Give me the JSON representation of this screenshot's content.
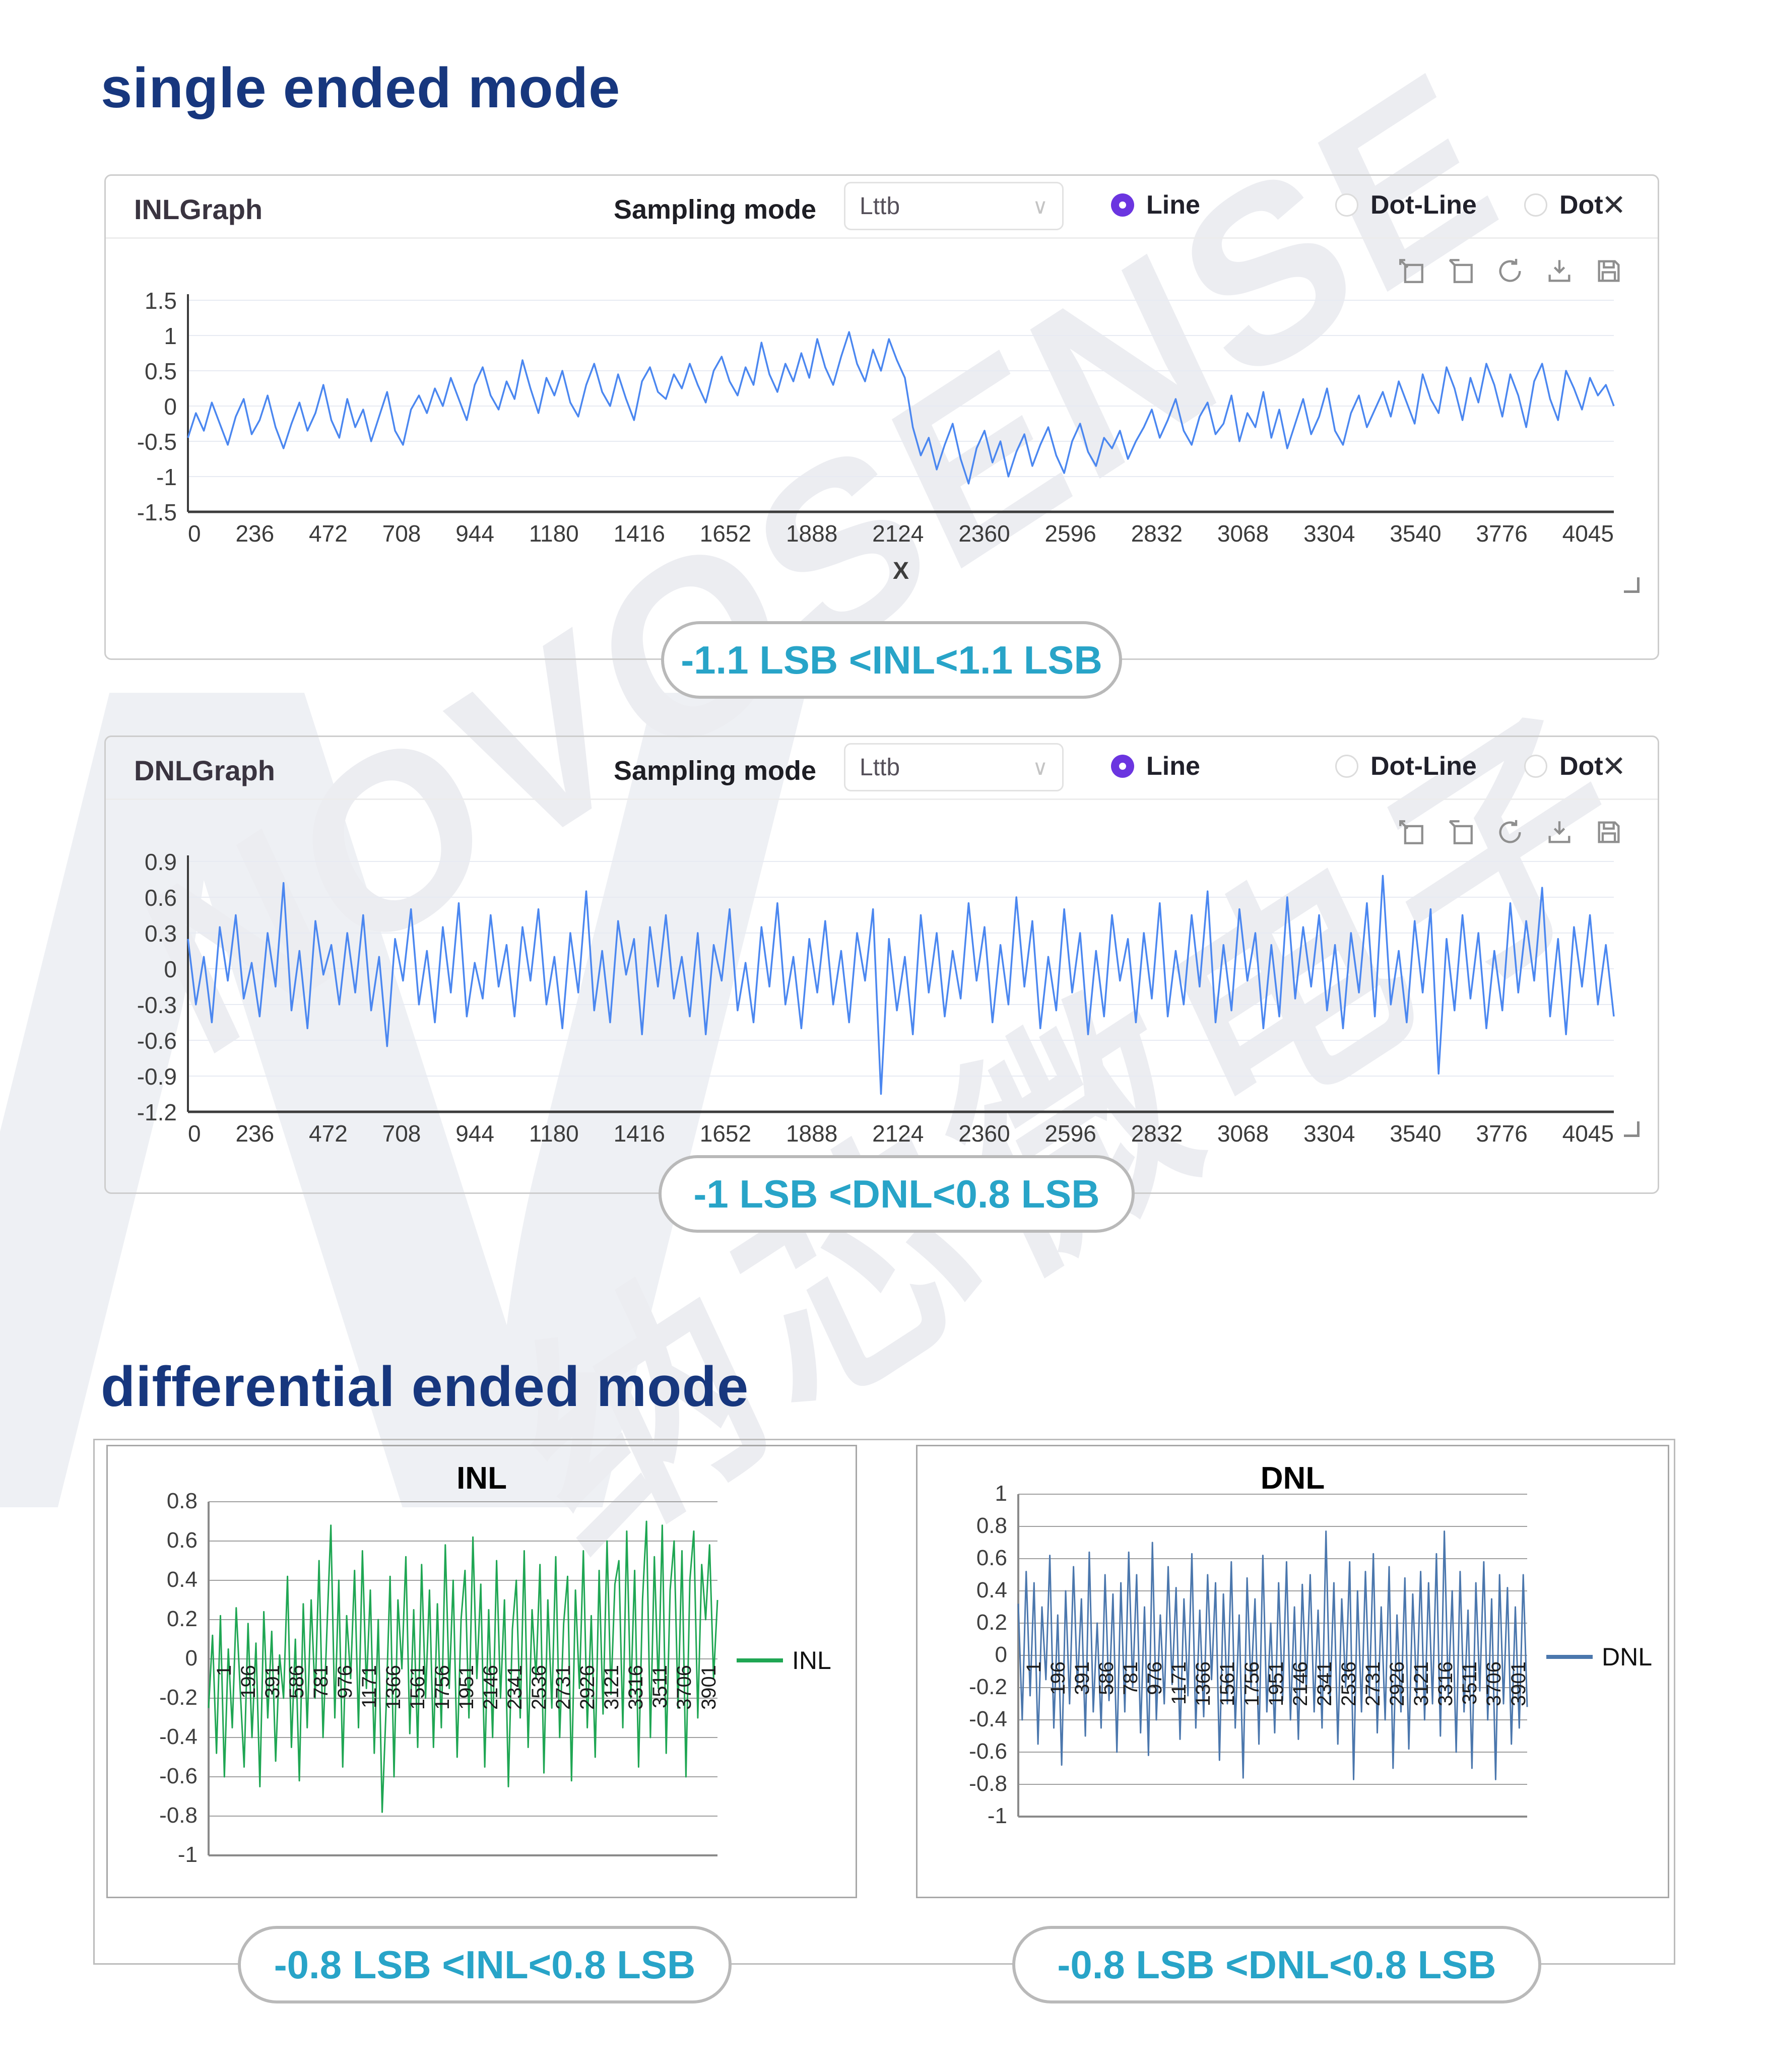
{
  "page": {
    "title1": "single ended mode",
    "title2": "differential ended mode"
  },
  "watermark": {
    "letter": "N",
    "line1": "NOVOSENSE",
    "line2": "纳芯微电子"
  },
  "toolbar": {
    "icons": [
      "zoom-in",
      "zoom-reset",
      "refresh",
      "download",
      "save"
    ]
  },
  "panels": [
    {
      "title": "INLGraph",
      "sampling_label": "Sampling mode",
      "sampling_value": "Lttb",
      "radios": [
        {
          "label": "Line",
          "selected": true
        },
        {
          "label": "Dot-Line",
          "selected": false
        },
        {
          "label": "Dot",
          "selected": false
        }
      ],
      "close": "✕"
    },
    {
      "title": "DNLGraph",
      "sampling_label": "Sampling mode",
      "sampling_value": "Lttb",
      "radios": [
        {
          "label": "Line",
          "selected": true
        },
        {
          "label": "Dot-Line",
          "selected": false
        },
        {
          "label": "Dot",
          "selected": false
        }
      ],
      "close": "✕"
    }
  ],
  "chart_data": [
    {
      "type": "line",
      "name": "INL single-ended",
      "color": "#4b87f0",
      "x_label": "X",
      "xlim": [
        0,
        4045
      ],
      "ylim": [
        -1.5,
        1.5
      ],
      "grid": true,
      "y_ticks": [
        "1.5",
        "1",
        "0.5",
        "0",
        "-0.5",
        "-1",
        "-1.5"
      ],
      "x_ticks": [
        "0",
        "236",
        "472",
        "708",
        "944",
        "1180",
        "1416",
        "1652",
        "1888",
        "2124",
        "2360",
        "2596",
        "2832",
        "3068",
        "3304",
        "3540",
        "3776",
        "4045"
      ],
      "annotation": "-1.1 LSB <INL<1.1 LSB",
      "values": [
        -0.45,
        -0.1,
        -0.35,
        0.05,
        -0.25,
        -0.55,
        -0.15,
        0.1,
        -0.4,
        -0.2,
        0.15,
        -0.3,
        -0.6,
        -0.25,
        0.05,
        -0.35,
        -0.1,
        0.3,
        -0.2,
        -0.45,
        0.1,
        -0.3,
        -0.05,
        -0.5,
        -0.15,
        0.2,
        -0.35,
        -0.55,
        -0.05,
        0.15,
        -0.1,
        0.25,
        0.0,
        0.4,
        0.1,
        -0.2,
        0.3,
        0.55,
        0.15,
        -0.05,
        0.35,
        0.1,
        0.65,
        0.25,
        -0.1,
        0.4,
        0.15,
        0.5,
        0.05,
        -0.15,
        0.3,
        0.6,
        0.2,
        0.0,
        0.45,
        0.1,
        -0.2,
        0.35,
        0.55,
        0.2,
        0.1,
        0.45,
        0.25,
        0.6,
        0.3,
        0.05,
        0.5,
        0.7,
        0.35,
        0.15,
        0.55,
        0.3,
        0.9,
        0.45,
        0.2,
        0.6,
        0.35,
        0.75,
        0.4,
        0.95,
        0.55,
        0.3,
        0.7,
        1.05,
        0.6,
        0.35,
        0.8,
        0.5,
        0.95,
        0.65,
        0.4,
        -0.3,
        -0.7,
        -0.45,
        -0.9,
        -0.55,
        -0.25,
        -0.75,
        -1.1,
        -0.6,
        -0.35,
        -0.8,
        -0.5,
        -1.0,
        -0.65,
        -0.4,
        -0.85,
        -0.55,
        -0.3,
        -0.7,
        -0.95,
        -0.5,
        -0.25,
        -0.65,
        -0.85,
        -0.45,
        -0.6,
        -0.35,
        -0.75,
        -0.5,
        -0.3,
        -0.05,
        -0.45,
        -0.2,
        0.1,
        -0.35,
        -0.55,
        -0.15,
        0.05,
        -0.4,
        -0.25,
        0.15,
        -0.5,
        -0.1,
        -0.3,
        0.2,
        -0.45,
        -0.05,
        -0.6,
        -0.25,
        0.1,
        -0.4,
        -0.15,
        0.25,
        -0.35,
        -0.55,
        -0.1,
        0.15,
        -0.3,
        -0.05,
        0.2,
        -0.15,
        0.35,
        0.05,
        -0.25,
        0.45,
        0.1,
        -0.1,
        0.55,
        0.25,
        -0.2,
        0.4,
        0.05,
        0.6,
        0.3,
        -0.15,
        0.45,
        0.15,
        -0.3,
        0.35,
        0.6,
        0.1,
        -0.2,
        0.5,
        0.25,
        -0.05,
        0.4,
        0.15,
        0.3,
        0.0
      ]
    },
    {
      "type": "line",
      "name": "DNL single-ended",
      "color": "#4b87f0",
      "x_label": "X",
      "xlim": [
        0,
        4045
      ],
      "ylim": [
        -1.2,
        0.9
      ],
      "grid": true,
      "y_ticks": [
        "0.9",
        "0.6",
        "0.3",
        "0",
        "-0.3",
        "-0.6",
        "-0.9",
        "-1.2"
      ],
      "x_ticks": [
        "0",
        "236",
        "472",
        "708",
        "944",
        "1180",
        "1416",
        "1652",
        "1888",
        "2124",
        "2360",
        "2596",
        "2832",
        "3068",
        "3304",
        "3540",
        "3776",
        "4045"
      ],
      "annotation": "-1 LSB <DNL<0.8 LSB",
      "values": [
        0.25,
        -0.3,
        0.1,
        -0.45,
        0.35,
        -0.1,
        0.45,
        -0.25,
        0.05,
        -0.4,
        0.3,
        -0.15,
        0.72,
        -0.35,
        0.15,
        -0.5,
        0.4,
        -0.05,
        0.2,
        -0.3,
        0.3,
        -0.2,
        0.45,
        -0.35,
        0.1,
        -0.65,
        0.25,
        -0.1,
        0.5,
        -0.3,
        0.15,
        -0.45,
        0.35,
        -0.2,
        0.55,
        -0.4,
        0.05,
        -0.25,
        0.45,
        -0.15,
        0.2,
        -0.4,
        0.35,
        -0.1,
        0.5,
        -0.3,
        0.1,
        -0.5,
        0.3,
        -0.2,
        0.65,
        -0.35,
        0.15,
        -0.45,
        0.4,
        -0.05,
        0.25,
        -0.55,
        0.35,
        -0.15,
        0.45,
        -0.25,
        0.1,
        -0.4,
        0.3,
        -0.55,
        0.2,
        -0.1,
        0.5,
        -0.35,
        0.05,
        -0.45,
        0.35,
        -0.15,
        0.55,
        -0.3,
        0.1,
        -0.5,
        0.25,
        -0.2,
        0.4,
        -0.3,
        0.15,
        -0.45,
        0.3,
        -0.1,
        0.5,
        -1.05,
        0.25,
        -0.35,
        0.1,
        -0.55,
        0.45,
        -0.2,
        0.3,
        -0.4,
        0.15,
        -0.25,
        0.55,
        -0.1,
        0.35,
        -0.45,
        0.2,
        -0.3,
        0.6,
        -0.15,
        0.4,
        -0.5,
        0.1,
        -0.35,
        0.5,
        -0.2,
        0.3,
        -0.55,
        0.15,
        -0.4,
        0.45,
        -0.1,
        0.25,
        -0.45,
        0.3,
        -0.25,
        0.55,
        -0.4,
        0.15,
        -0.3,
        0.45,
        -0.15,
        0.65,
        -0.45,
        0.2,
        -0.35,
        0.5,
        -0.1,
        0.3,
        -0.5,
        0.2,
        -0.4,
        0.6,
        -0.25,
        0.35,
        -0.15,
        0.45,
        -0.35,
        0.2,
        -0.5,
        0.3,
        -0.2,
        0.55,
        -0.4,
        0.78,
        -0.3,
        0.15,
        -0.45,
        0.4,
        -0.2,
        0.5,
        -0.88,
        0.25,
        -0.35,
        0.45,
        -0.25,
        0.3,
        -0.5,
        0.15,
        -0.35,
        0.55,
        -0.2,
        0.4,
        -0.1,
        0.68,
        -0.4,
        0.25,
        -0.55,
        0.35,
        -0.15,
        0.45,
        -0.3,
        0.2,
        -0.4
      ]
    },
    {
      "type": "line",
      "name": "INL differential",
      "title": "INL",
      "legend": "INL",
      "color": "#1fa653",
      "xlim": [
        1,
        3996
      ],
      "ylim": [
        -1,
        0.8
      ],
      "grid": true,
      "legend_position": "right",
      "y_ticks": [
        "0.8",
        "0.6",
        "0.4",
        "0.2",
        "0",
        "-0.2",
        "-0.4",
        "-0.6",
        "-0.8",
        "-1"
      ],
      "x_ticks": [
        "1",
        "196",
        "391",
        "586",
        "781",
        "976",
        "1171",
        "1366",
        "1561",
        "1756",
        "1951",
        "2146",
        "2341",
        "2536",
        "2731",
        "2926",
        "3121",
        "3316",
        "3511",
        "3706",
        "3901"
      ],
      "annotation": "-0.8 LSB <INL<0.8 LSB",
      "values": [
        -0.25,
        0.12,
        -0.48,
        0.22,
        -0.6,
        0.05,
        -0.35,
        0.26,
        -0.15,
        -0.55,
        0.18,
        -0.4,
        0.08,
        -0.65,
        0.24,
        -0.3,
        0.14,
        -0.52,
        0.02,
        -0.2,
        0.42,
        -0.45,
        0.1,
        -0.62,
        0.28,
        -0.35,
        0.3,
        -0.2,
        0.5,
        -0.4,
        0.15,
        0.68,
        -0.3,
        0.4,
        -0.55,
        0.22,
        -0.1,
        0.45,
        -0.35,
        0.55,
        -0.15,
        0.35,
        -0.48,
        0.2,
        -0.78,
        -0.25,
        0.42,
        -0.6,
        0.3,
        -0.05,
        0.52,
        -0.38,
        0.25,
        -0.45,
        0.48,
        -0.2,
        0.35,
        -0.45,
        0.28,
        -0.35,
        0.58,
        -0.15,
        0.4,
        -0.5,
        0.2,
        0.45,
        -0.3,
        0.62,
        -0.1,
        0.38,
        -0.55,
        0.25,
        -0.4,
        0.5,
        -0.2,
        0.3,
        -0.65,
        0.15,
        0.4,
        -0.3,
        0.55,
        -0.45,
        0.25,
        -0.1,
        0.48,
        -0.58,
        0.3,
        -0.25,
        0.52,
        -0.4,
        0.18,
        0.42,
        -0.62,
        0.35,
        -0.15,
        0.55,
        -0.35,
        0.22,
        -0.5,
        0.45,
        -0.28,
        0.6,
        -0.18,
        0.38,
        0.5,
        -0.35,
        0.65,
        -0.2,
        0.45,
        -0.55,
        0.3,
        0.7,
        -0.4,
        0.52,
        -0.15,
        0.68,
        -0.48,
        0.35,
        0.6,
        -0.25,
        0.55,
        -0.6,
        0.4,
        0.65,
        -0.3,
        0.48,
        0.2,
        0.58,
        -0.1,
        0.3
      ]
    },
    {
      "type": "line",
      "name": "DNL differential",
      "title": "DNL",
      "legend": "DNL",
      "color": "#4b77ad",
      "xlim": [
        1,
        3996
      ],
      "ylim": [
        -1,
        1
      ],
      "grid": true,
      "legend_position": "right",
      "y_ticks": [
        "1",
        "0.8",
        "0.6",
        "0.4",
        "0.2",
        "0",
        "-0.2",
        "-0.4",
        "-0.6",
        "-0.8",
        "-1"
      ],
      "x_ticks": [
        "1",
        "196",
        "391",
        "586",
        "781",
        "976",
        "1171",
        "1366",
        "1561",
        "1756",
        "1951",
        "2146",
        "2341",
        "2536",
        "2731",
        "2926",
        "3121",
        "3316",
        "3511",
        "3706",
        "3901"
      ],
      "annotation": "-0.8 LSB <DNL<0.8 LSB",
      "values": [
        0.32,
        -0.4,
        0.52,
        -0.25,
        0.45,
        -0.55,
        0.3,
        -0.15,
        0.62,
        -0.45,
        0.25,
        -0.68,
        0.4,
        -0.3,
        0.55,
        -0.2,
        0.35,
        -0.5,
        0.64,
        -0.35,
        0.2,
        -0.45,
        0.5,
        -0.28,
        0.38,
        -0.6,
        0.45,
        -0.35,
        0.64,
        -0.2,
        0.5,
        -0.48,
        0.3,
        -0.62,
        0.7,
        -0.4,
        0.25,
        -0.3,
        0.55,
        -0.18,
        0.42,
        -0.52,
        0.35,
        -0.25,
        0.63,
        -0.45,
        0.28,
        -0.38,
        0.5,
        -0.15,
        0.45,
        -0.65,
        0.38,
        -0.3,
        0.58,
        -0.45,
        0.25,
        -0.76,
        0.48,
        -0.2,
        0.35,
        -0.55,
        0.62,
        -0.35,
        0.2,
        -0.48,
        0.45,
        -0.28,
        0.58,
        -0.4,
        0.3,
        -0.52,
        0.44,
        -0.22,
        0.5,
        -0.35,
        0.28,
        -0.45,
        0.77,
        -0.3,
        0.45,
        -0.55,
        0.35,
        -0.2,
        0.58,
        -0.77,
        0.4,
        -0.35,
        0.52,
        -0.25,
        0.63,
        -0.48,
        0.3,
        -0.4,
        0.55,
        -0.7,
        0.25,
        -0.35,
        0.48,
        -0.58,
        0.38,
        -0.25,
        0.52,
        -0.4,
        0.45,
        -0.3,
        0.63,
        -0.5,
        0.77,
        -0.25,
        0.4,
        -0.6,
        0.52,
        -0.35,
        0.28,
        -0.7,
        0.45,
        -0.22,
        0.58,
        -0.4,
        0.35,
        -0.77,
        0.5,
        -0.3,
        0.42,
        -0.55,
        0.3,
        -0.45,
        0.5,
        -0.32
      ]
    }
  ]
}
